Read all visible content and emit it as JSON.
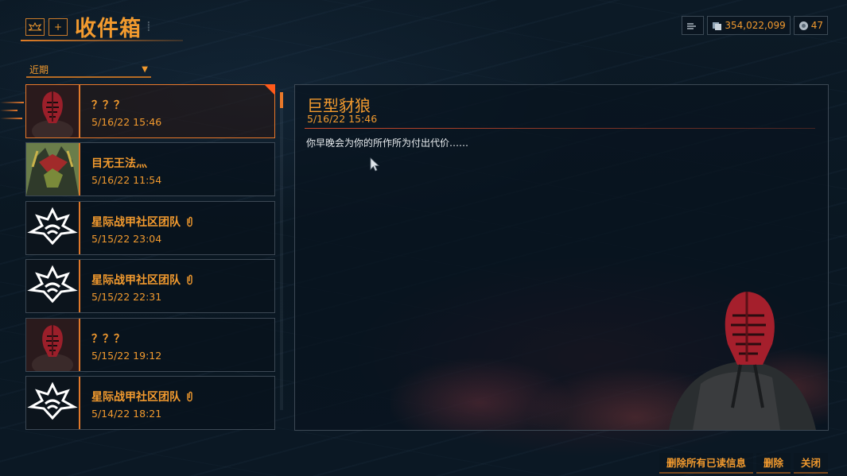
{
  "header": {
    "title": "收件箱",
    "title_dots": "⁞",
    "plus_label": "+"
  },
  "currency": {
    "credits": "354,022,099",
    "platinum": "47"
  },
  "filter": {
    "selected": "近期",
    "arrow": "▼"
  },
  "messages": [
    {
      "sender": "？？？",
      "date": "5/16/22 15:46",
      "avatar": "red-mask-warframe",
      "has_attachment": false,
      "selected": true
    },
    {
      "sender": "目无王法灬",
      "date": "5/16/22 11:54",
      "avatar": "player-warframe",
      "has_attachment": false,
      "selected": false
    },
    {
      "sender": "星际战甲社区团队",
      "date": "5/15/22 23:04",
      "avatar": "lotus-logo",
      "has_attachment": true,
      "selected": false
    },
    {
      "sender": "星际战甲社区团队",
      "date": "5/15/22 22:31",
      "avatar": "lotus-logo",
      "has_attachment": true,
      "selected": false
    },
    {
      "sender": "？？？",
      "date": "5/15/22 19:12",
      "avatar": "red-mask-warframe",
      "has_attachment": false,
      "selected": false
    },
    {
      "sender": "星际战甲社区团队",
      "date": "5/14/22 18:21",
      "avatar": "lotus-logo",
      "has_attachment": true,
      "selected": false
    }
  ],
  "detail": {
    "title": "巨型豺狼",
    "date": "5/16/22 15:46",
    "body": "你早晚会为你的所作所为付出代价……"
  },
  "footer": {
    "delete_all_read": "删除所有已读信息",
    "delete": "删除",
    "close": "关闭"
  },
  "colors": {
    "accent": "#f29a2e",
    "selected_border": "#e8782a",
    "unread_marker": "#ff5a1a"
  }
}
